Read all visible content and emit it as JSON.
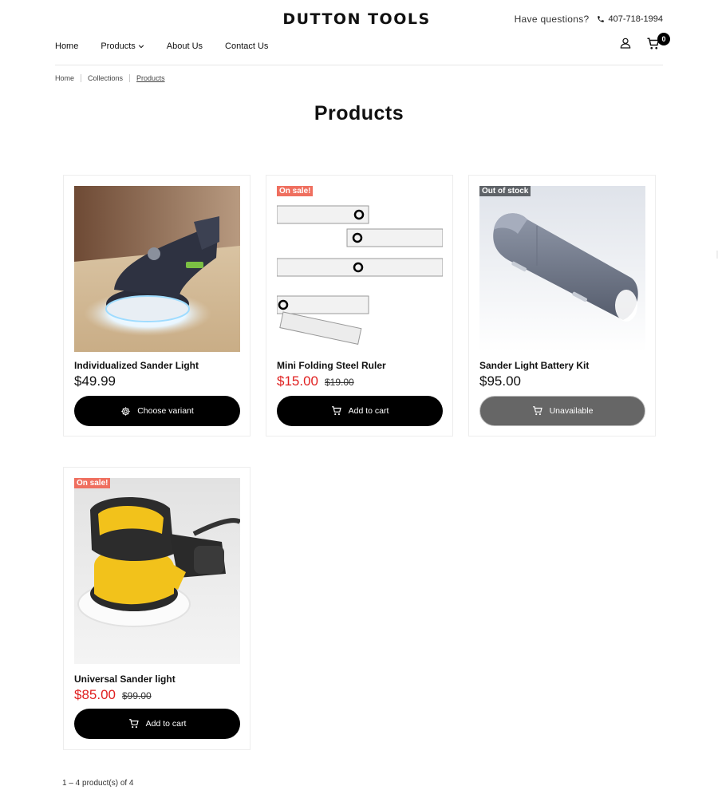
{
  "header": {
    "logo": "DUTTON TOOLS",
    "questions": "Have questions?",
    "phone": "407-718-1994",
    "cart_count": "0"
  },
  "nav": {
    "items": [
      "Home",
      "Products",
      "About Us",
      "Contact Us"
    ]
  },
  "breadcrumb": [
    "Home",
    "Collections",
    "Products"
  ],
  "page": {
    "title": "Products",
    "pagination": "1 – 4 product(s) of 4"
  },
  "products": [
    {
      "name": "Individualized Sander Light",
      "price": "$49.99",
      "compare_price": "",
      "badge": "",
      "button": "Choose variant",
      "button_icon": "gear-icon"
    },
    {
      "name": "Mini Folding Steel Ruler",
      "price": "$15.00",
      "compare_price": "$19.00",
      "badge": "On sale!",
      "button": "Add to cart",
      "button_icon": "cart-icon"
    },
    {
      "name": "Sander Light Battery Kit",
      "price": "$95.00",
      "compare_price": "",
      "badge": "Out of stock",
      "button": "Unavailable",
      "button_icon": "cart-icon"
    },
    {
      "name": "Universal Sander light",
      "price": "$85.00",
      "compare_price": "$99.00",
      "badge": "On sale!",
      "button": "Add to cart",
      "button_icon": "cart-icon"
    }
  ],
  "colors": {
    "sale_price": "#e02020",
    "sale_badge": "#ef6f5f",
    "oos_badge": "#5f6368",
    "button": "#000000",
    "button_disabled": "#666666"
  }
}
